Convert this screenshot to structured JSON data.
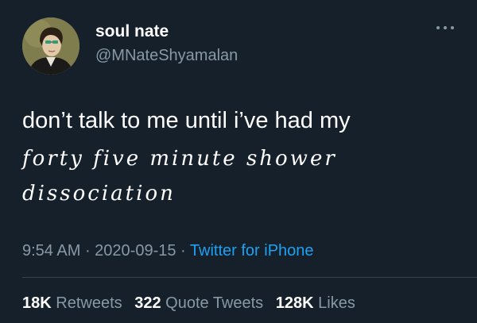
{
  "author": {
    "display_name": "soul nate",
    "handle": "@MNateShyamalan"
  },
  "tweet": {
    "text_line1": "don’t talk to me until i’ve had my",
    "text_script": "forty five minute shower dissociation"
  },
  "meta": {
    "time": "9:54 AM",
    "separator1": " · ",
    "date": "2020-09-15",
    "separator2": " · ",
    "source": "Twitter for iPhone"
  },
  "stats": {
    "retweets_count": "18K",
    "retweets_label": "Retweets",
    "quotes_count": "322",
    "quotes_label": "Quote Tweets",
    "likes_count": "128K",
    "likes_label": "Likes"
  },
  "colors": {
    "background": "#15202b",
    "secondary_text": "#8899a6",
    "link": "#1da1f2"
  },
  "icons": {
    "more": "more-horizontal-icon"
  }
}
